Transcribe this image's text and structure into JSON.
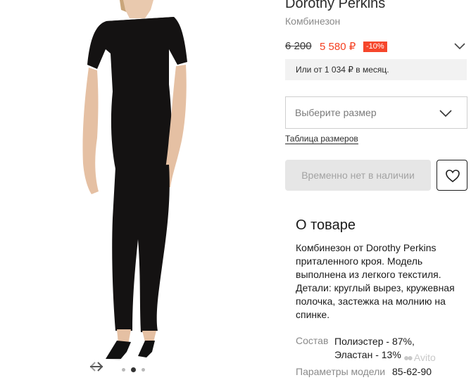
{
  "product": {
    "brand": "Dorothy Perkins",
    "subtitle": "Комбинезон",
    "old_price": "6 200",
    "new_price": "5 580 ₽",
    "discount": "-10%",
    "installment": "Или от 1 034 ₽ в месяц."
  },
  "size": {
    "placeholder": "Выберите размер",
    "table_link": "Таблица размеров"
  },
  "actions": {
    "out_of_stock": "Временно нет в наличии"
  },
  "about": {
    "title": "О товаре",
    "description": "Комбинезон от Dorothy Perkins приталенного кроя. Модель выполнена из легкого текстиля. Детали: круглый вырез, кружевная полочка, застежка на молнию на спинке.",
    "specs": [
      {
        "label": "Состав",
        "value": "Полиэстер - 87%, Эластан - 13%"
      },
      {
        "label": "Параметры модели",
        "value": "85-62-90"
      }
    ]
  },
  "gallery": {
    "active_slide_index": 2,
    "slide_count": 3
  },
  "watermark": {
    "text": "Avito"
  },
  "colors": {
    "price_red": "#f53f20",
    "discount_bg": "#f6462b",
    "button_disabled_bg": "#e6e6e6"
  },
  "icons": [
    "chevron-down-icon",
    "heart-icon",
    "arrow-left-icon",
    "arrow-right-icon"
  ]
}
